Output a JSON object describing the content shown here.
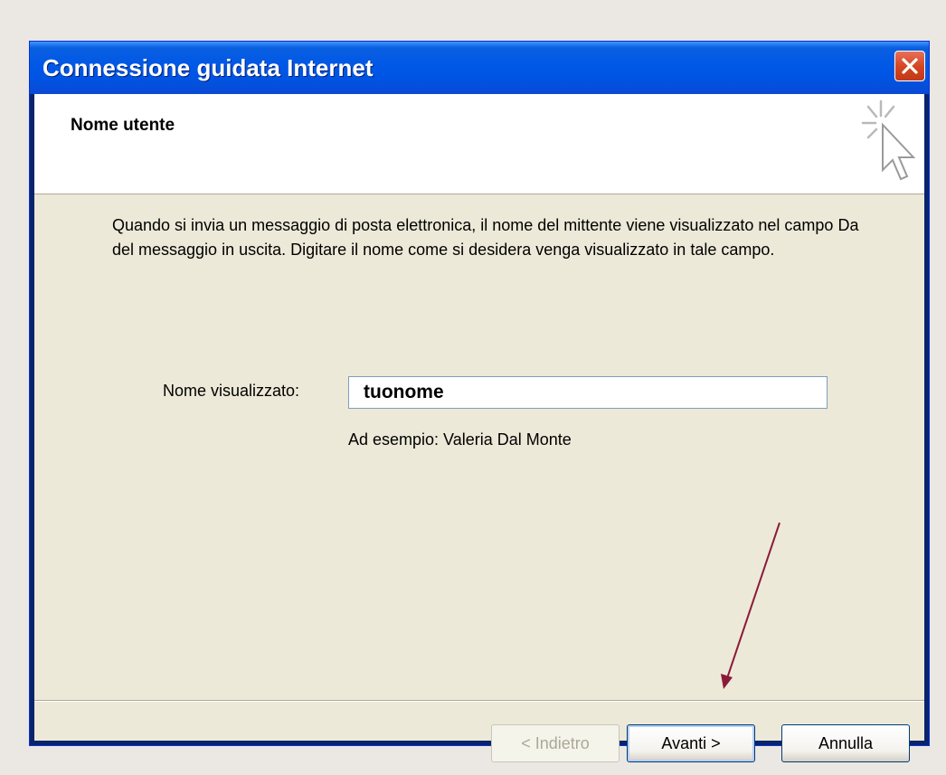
{
  "window": {
    "title": "Connessione guidata Internet"
  },
  "header": {
    "title": "Nome utente",
    "icon": "wizard-cursor-icon"
  },
  "main": {
    "description": "Quando si invia un messaggio di posta elettronica, il nome del mittente viene visualizzato nel campo Da del messaggio in uscita. Digitare il nome come si desidera venga visualizzato in tale campo.",
    "name_label": "Nome visualizzato:",
    "name_value": "tuonome",
    "example": "Ad esempio: Valeria Dal Monte"
  },
  "buttons": {
    "back_label": "< Indietro",
    "next_label": "Avanti >",
    "cancel_label": "Annulla"
  },
  "colors": {
    "titlebar": "#0054e3",
    "dialog_bg": "#ece9d8",
    "annotation_arrow": "#8b1a3a"
  }
}
